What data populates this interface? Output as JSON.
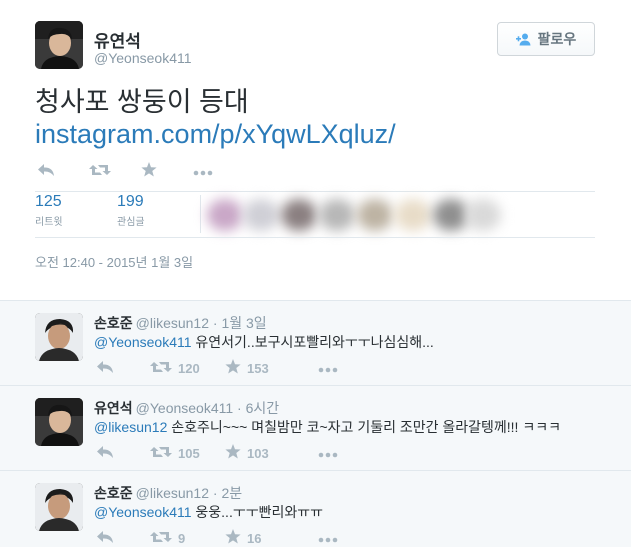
{
  "main_tweet": {
    "name": "유연석",
    "handle": "@Yeonseok411",
    "follow_label": "팔로우",
    "text": "청사포 쌍둥이 등대",
    "link": "instagram.com/p/xYqwLXqluz/",
    "stats": {
      "retweets_count": "125",
      "retweets_label": "리트윗",
      "favorites_count": "199",
      "favorites_label": "관심글"
    },
    "timestamp": "오전 12:40 - 2015년 1월 3일"
  },
  "replies": [
    {
      "name": "손호준",
      "handle": "@likesun12",
      "time": "· 1월 3일",
      "mention": "@Yeonseok411",
      "text": " 유연서기..보구시포빨리와ㅜㅜ나심심해...",
      "retweets": "120",
      "favorites": "153"
    },
    {
      "name": "유연석",
      "handle": "@Yeonseok411",
      "time": "· 6시간",
      "mention": "@likesun12",
      "text": " 손호주니~~~ 며칠밤만 코~자고 기둘리 조만간 올라갈텡께!!! ㅋㅋㅋ",
      "retweets": "105",
      "favorites": "103"
    },
    {
      "name": "손호준",
      "handle": "@likesun12",
      "time": "· 2분",
      "mention": "@Yeonseok411",
      "text": " 웅웅...ㅜㅜ빤리와ㅠㅠ",
      "retweets": "9",
      "favorites": "16"
    }
  ],
  "icons": {
    "reply": "reply-icon",
    "retweet": "retweet-icon",
    "favorite": "star-icon",
    "more": "more-icon",
    "follow": "add-user-icon"
  },
  "colors": {
    "link": "#2b7bb9",
    "muted": "#8899a6",
    "icon": "#aab8c2",
    "reply_background": "#f5f8fa",
    "follow_icon": "#55acee"
  }
}
